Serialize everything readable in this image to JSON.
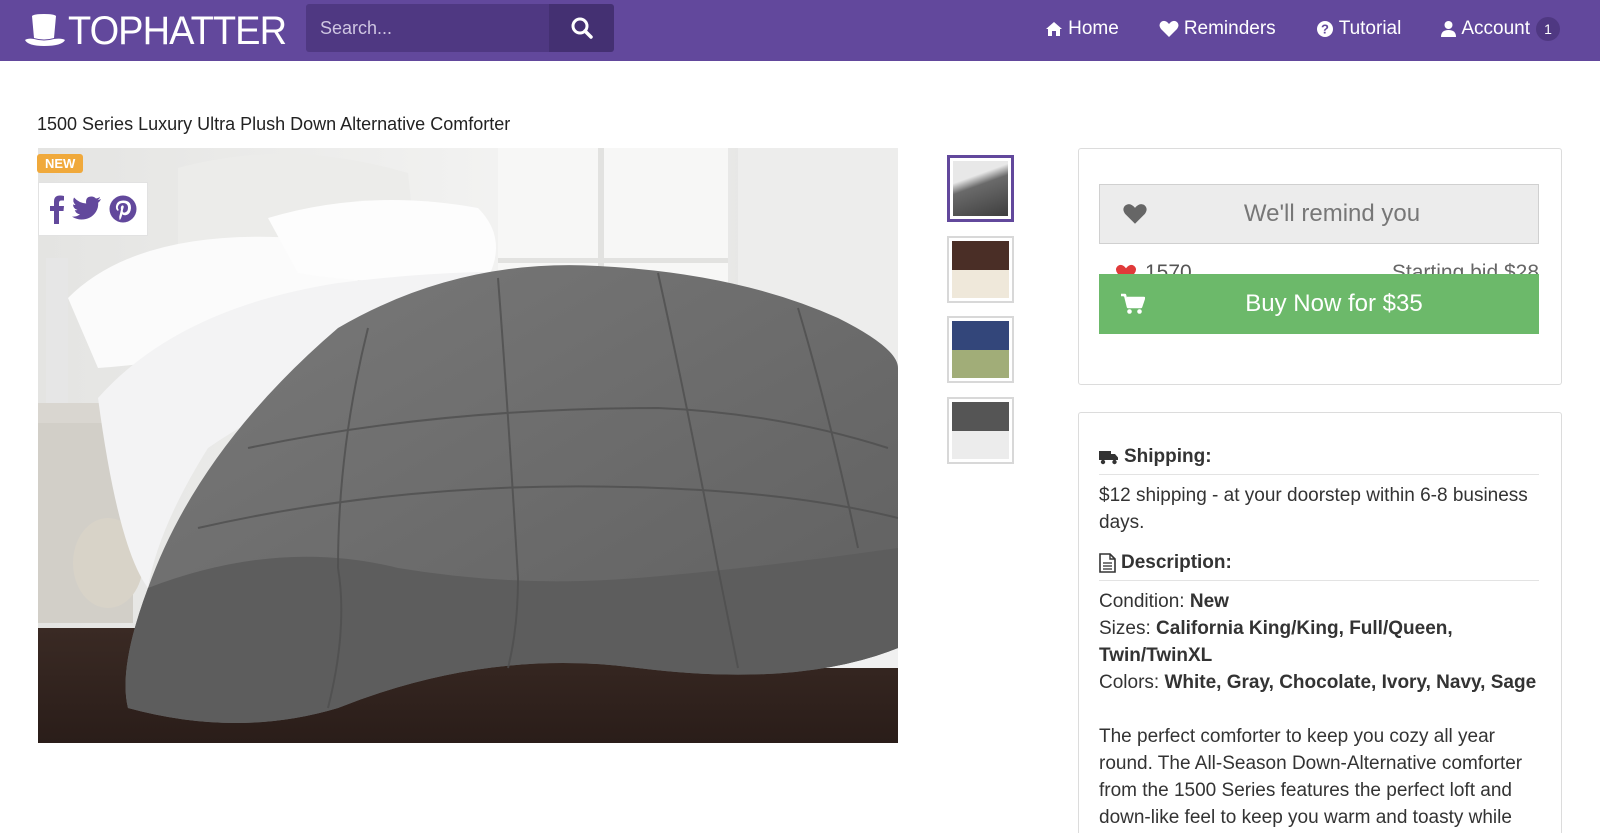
{
  "brand": {
    "logo_text": "TOPHATTER",
    "accent": "#62489c",
    "buy_color": "#6cb96a",
    "new_badge_color": "#f0a93b"
  },
  "search": {
    "placeholder": "Search...",
    "icon": "search-icon"
  },
  "nav": {
    "home": {
      "label": "Home",
      "icon": "home-icon"
    },
    "reminders": {
      "label": "Reminders",
      "icon": "heart-icon"
    },
    "tutorial": {
      "label": "Tutorial",
      "icon": "question-icon"
    },
    "account": {
      "label": "Account",
      "icon": "user-icon",
      "badge": "1"
    }
  },
  "product": {
    "title": "1500 Series Luxury Ultra Plush Down Alternative Comforter",
    "new_label": "NEW",
    "share": [
      "facebook-icon",
      "twitter-icon",
      "pinterest-icon"
    ],
    "thumbnails": [
      "gray",
      "chocolate-ivory",
      "navy-sage",
      "gray-white"
    ]
  },
  "bid": {
    "remind_label": "We'll remind you",
    "likes": "1570",
    "starting_bid": "Starting bid $28",
    "buy_label": "Buy Now for $35"
  },
  "shipping": {
    "heading": "Shipping:",
    "text": "$12 shipping - at your doorstep within 6-8 business days."
  },
  "description": {
    "heading": "Description:",
    "condition_label": "Condition: ",
    "condition_value": "New",
    "sizes_label": "Sizes: ",
    "sizes_value": "California King/King, Full/Queen, Twin/TwinXL",
    "colors_label": "Colors: ",
    "colors_value": "White, Gray, Chocolate, Ivory, Navy, Sage",
    "body": "The perfect comforter to keep you cozy all year round. The All-Season Down-Alternative comforter from the 1500 Series features the perfect loft and down-like feel to keep you warm and toasty while"
  }
}
